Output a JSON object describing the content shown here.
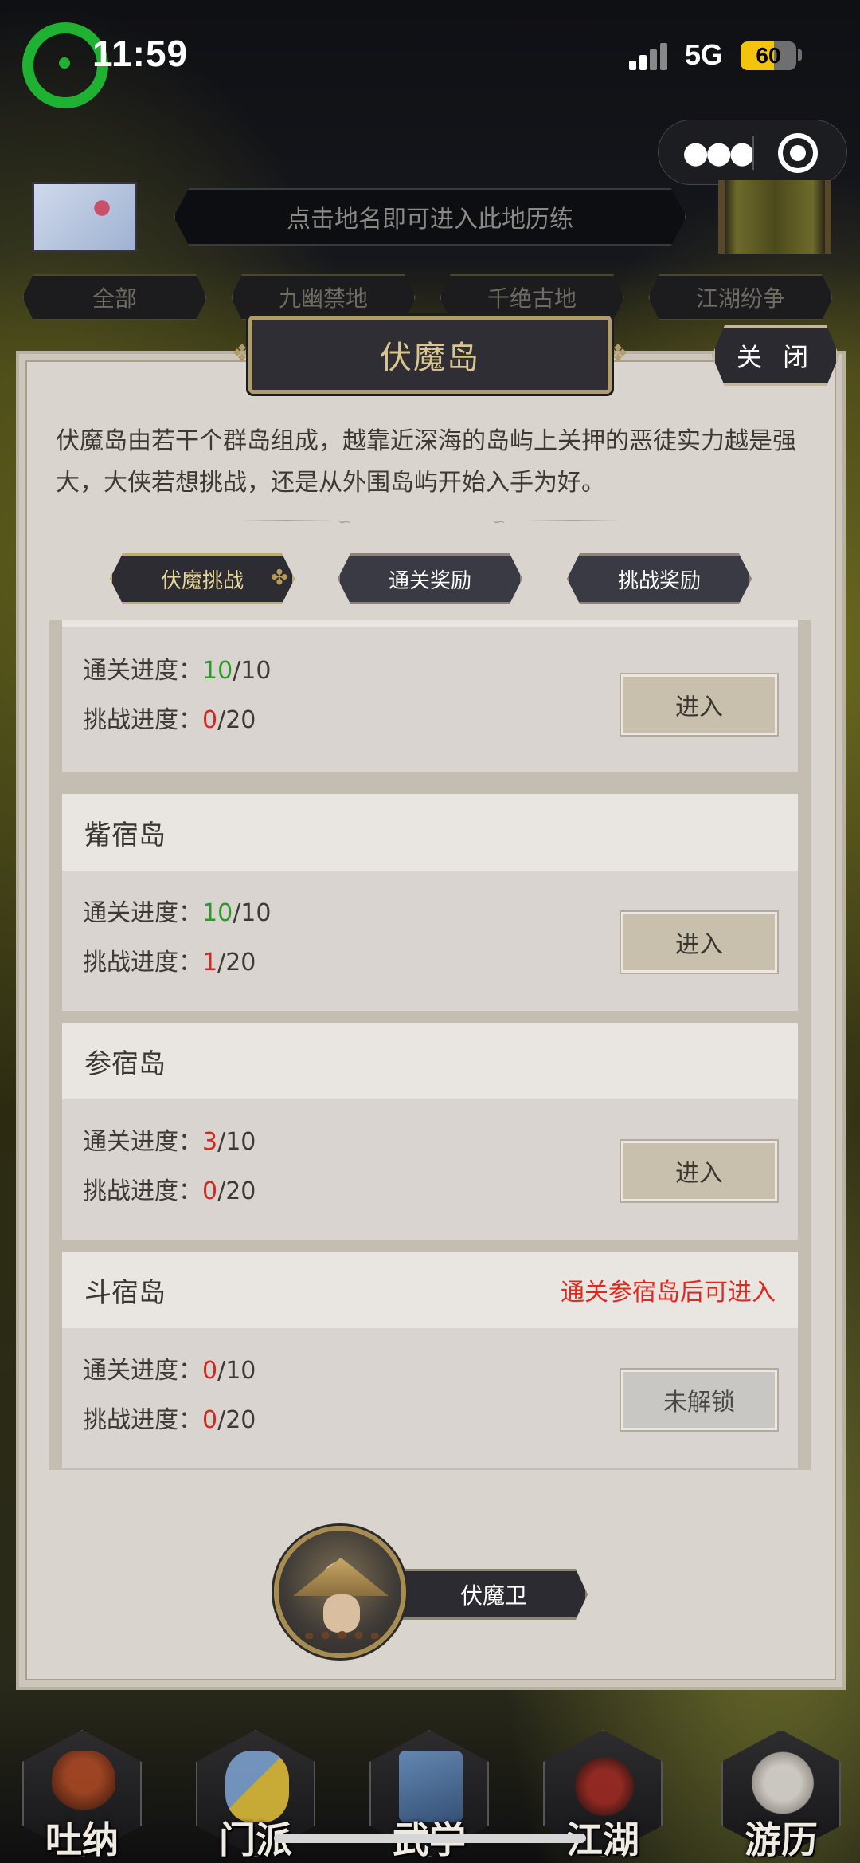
{
  "status_bar": {
    "time": "11:59",
    "network": "5G",
    "battery": "60",
    "battery_level": 0.6,
    "colors": {
      "app_logo": "#1fb131",
      "battery_fill": "#f4c30b"
    }
  },
  "top_bar": {
    "hint": "点击地名即可进入此地历练",
    "filters": [
      "全部",
      "九幽禁地",
      "千绝古地",
      "江湖纷争"
    ]
  },
  "modal": {
    "title": "伏魔岛",
    "close_label": "关 闭",
    "description": "伏魔岛由若干个群岛组成，越靠近深海的岛屿上关押的恶徒实力越是强大，大侠若想挑战，还是从外围岛屿开始入手为好。",
    "tabs": [
      {
        "label": "伏魔挑战",
        "active": true
      },
      {
        "label": "通关奖励",
        "active": false
      },
      {
        "label": "挑战奖励",
        "active": false
      }
    ],
    "progress_labels": {
      "clear": "通关进度：",
      "challenge": "挑战进度："
    },
    "islands": [
      {
        "name": "",
        "lock_text": "",
        "clear_current": "10",
        "clear_total": "/10",
        "clear_color": "green",
        "challenge_current": "0",
        "challenge_total": "/20",
        "button": "进入",
        "locked": false
      },
      {
        "name": "觜宿岛",
        "lock_text": "",
        "clear_current": "10",
        "clear_total": "/10",
        "clear_color": "green",
        "challenge_current": "1",
        "challenge_total": "/20",
        "button": "进入",
        "locked": false
      },
      {
        "name": "参宿岛",
        "lock_text": "",
        "clear_current": "3",
        "clear_total": "/10",
        "clear_color": "red",
        "challenge_current": "0",
        "challenge_total": "/20",
        "button": "进入",
        "locked": false
      },
      {
        "name": "斗宿岛",
        "lock_text": "通关参宿岛后可进入",
        "clear_current": "0",
        "clear_total": "/10",
        "clear_color": "red",
        "challenge_current": "0",
        "challenge_total": "/20",
        "button": "未解锁",
        "locked": true
      }
    ],
    "npc_label": "伏魔卫"
  },
  "bottom_nav": [
    {
      "label": "吐纳",
      "icon": "monk-icon",
      "active": false
    },
    {
      "label": "门派",
      "icon": "sect-banner-icon",
      "active": false
    },
    {
      "label": "武学",
      "icon": "martial-book-icon",
      "active": false
    },
    {
      "label": "江湖",
      "icon": "straw-hat-icon",
      "active": false
    },
    {
      "label": "游历",
      "icon": "horse-icon",
      "active": true
    }
  ]
}
